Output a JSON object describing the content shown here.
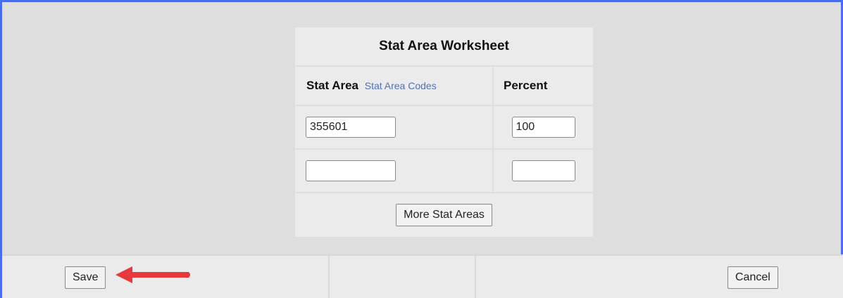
{
  "worksheet": {
    "title": "Stat Area Worksheet",
    "stat_area_header": "Stat Area",
    "stat_area_codes_link": "Stat Area Codes",
    "percent_header": "Percent",
    "rows": [
      {
        "stat_area": "355601",
        "percent": "100"
      },
      {
        "stat_area": "",
        "percent": ""
      }
    ],
    "more_button": "More Stat Areas"
  },
  "footer": {
    "save_label": "Save",
    "cancel_label": "Cancel"
  },
  "colors": {
    "frame_border": "#4a6cf0",
    "arrow": "#e8383b",
    "link": "#4d72b8"
  },
  "icons": [
    "red-arrow-icon"
  ]
}
